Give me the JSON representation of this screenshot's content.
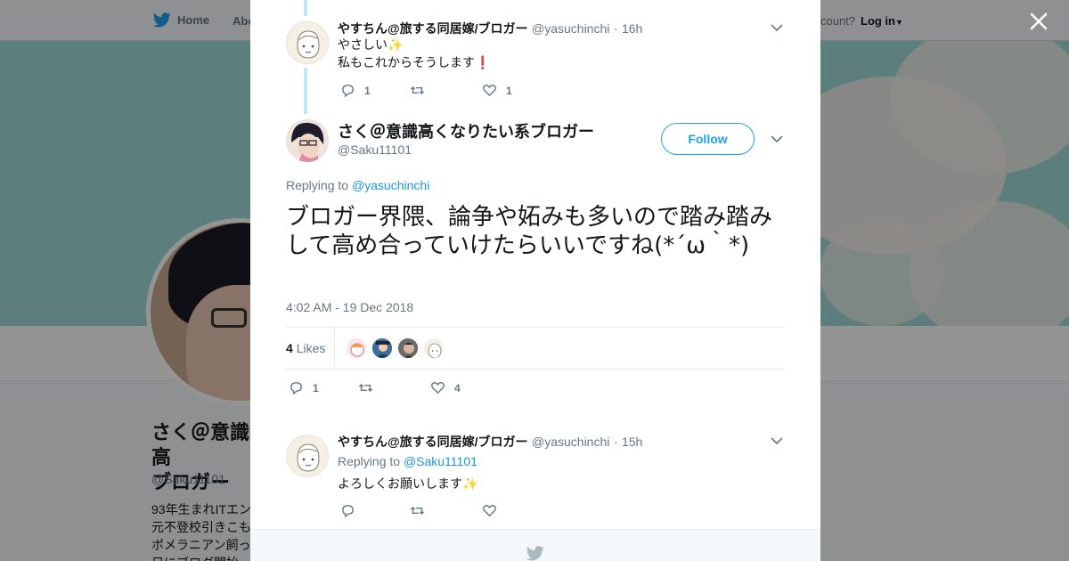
{
  "background": {
    "nav": {
      "home_label": "Home",
      "about_label": "Abo",
      "account_prompt": "count?",
      "login_label": "Log in"
    },
    "profile": {
      "name": "さく＠意識高\nブロガー",
      "handle": "@Saku11101",
      "bio_lines": [
        "93年生まれITエン",
        "元不登校引きこも",
        "ポメラニアン飼っ",
        "日にブログ開始"
      ]
    }
  },
  "modal": {
    "prev_reply": {
      "name": "やすちん@旅する同居嫁/ブロガー",
      "handle": "@yasuchinchi",
      "time": "16h",
      "line1": "やさしい✨",
      "line2": "私もこれからそうします❗",
      "reply_count": "1",
      "retweet_count": "",
      "like_count": "1"
    },
    "main_tweet": {
      "name": "さく＠意識高くなりたい系ブロガー",
      "handle": "@Saku11101",
      "follow_label": "Follow",
      "replying_prefix": "Replying to",
      "replying_to": "@yasuchinchi",
      "text": "ブロガー界隈、論争や妬みも多いので踏み踏みして高め合っていけたらいいですね(*´ω｀*)",
      "timestamp": "4:02 AM - 19 Dec 2018",
      "likes_count": "4",
      "likes_label": "Likes",
      "reply_count": "1",
      "retweet_count": "",
      "like_count": "4"
    },
    "reply": {
      "name": "やすちん@旅する同居嫁/ブロガー",
      "handle": "@yasuchinchi",
      "time": "15h",
      "replying_prefix": "Replying to",
      "replying_to": "@Saku11101",
      "text": "よろしくお願いします✨",
      "reply_count": "",
      "retweet_count": "",
      "like_count": ""
    }
  },
  "colors": {
    "accent": "#1da1f2",
    "link": "#1b95e0",
    "muted": "#657786",
    "thread": "#c4e5f9"
  },
  "icons": [
    "twitter-bird-icon",
    "close-icon",
    "chevron-down-icon",
    "reply-icon",
    "retweet-icon",
    "like-icon",
    "caret-down-icon"
  ]
}
